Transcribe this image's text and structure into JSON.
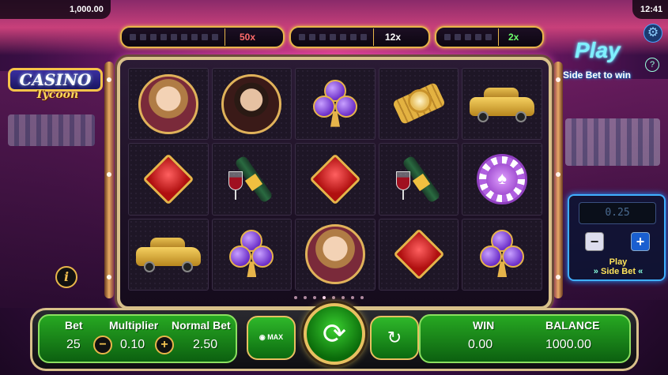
{
  "status": {
    "balance_top": "1,000.00",
    "clock": "12:41"
  },
  "jackpot_meters": [
    {
      "multiplier": "50x",
      "color": "#ff6b6b"
    },
    {
      "multiplier": "12x",
      "color": "#ffffff"
    },
    {
      "multiplier": "2x",
      "color": "#6dff6d"
    }
  ],
  "logo": {
    "title": "CASINO",
    "subtitle": "Tycoon"
  },
  "side_bet": {
    "title": "Play",
    "subtitle": "Side Bet to win",
    "display_value": "0.25",
    "play_label_line1": "Play",
    "play_label_line2": "Side Bet",
    "minus": "−",
    "plus": "+"
  },
  "reels": [
    [
      "lady-portrait",
      "gentleman-portrait",
      "club",
      "gold-watch",
      "gold-car"
    ],
    [
      "diamond",
      "champagne",
      "diamond",
      "champagne",
      "spade-chip"
    ],
    [
      "gold-car",
      "club",
      "lady-portrait",
      "diamond",
      "club"
    ]
  ],
  "controls": {
    "bet_label": "Bet",
    "bet_value": "25",
    "multiplier_label": "Multiplier",
    "multiplier_value": "0.10",
    "normal_bet_label": "Normal Bet",
    "normal_bet_value": "2.50",
    "win_label": "WIN",
    "win_value": "0.00",
    "balance_label": "BALANCE",
    "balance_value": "1000.00",
    "max_label": "MAX",
    "info": "i"
  },
  "colors": {
    "accent_gold": "#e8b64a",
    "panel_green": "#27a822",
    "side_bet_blue": "#40b0ff"
  }
}
